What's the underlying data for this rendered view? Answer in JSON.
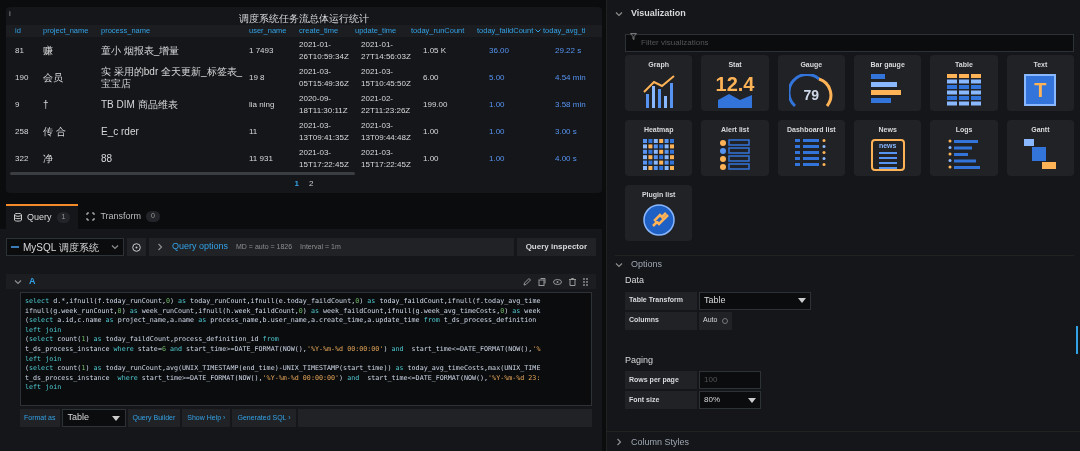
{
  "panel": {
    "title": "调度系统任务流总体运行统计",
    "info": "i",
    "columns": [
      {
        "label": "id",
        "sorted": false
      },
      {
        "label": "project_name",
        "sorted": false
      },
      {
        "label": "process_name",
        "sorted": false
      },
      {
        "label": "user_name",
        "sorted": false
      },
      {
        "label": "create_time",
        "sorted": false
      },
      {
        "label": "update_time",
        "sorted": false
      },
      {
        "label": "today_runCount",
        "sorted": false
      },
      {
        "label": "today_faildCount",
        "sorted": true
      },
      {
        "label": "today_avg_ti",
        "sorted": false
      }
    ],
    "rows": [
      [
        "81",
        "赚",
        "童小 烟报表_增量",
        "1 7493",
        "2021-01-26T10:59:34Z",
        "2021-01-27T14:56:03Z",
        "1.05 K",
        "36.00",
        "29.22 s"
      ],
      [
        "190",
        "会员",
        "实 采用的bdr 全天更新_标签表_宝宝店",
        "19 8",
        "2021-03-05T15:49:36Z",
        "2021-03-15T10:45:50Z",
        "6.00",
        "5.00",
        "4.54 min"
      ],
      [
        "9",
        "†",
        "TB DIM 商品维表",
        "lia ning",
        "2020-09-18T11:30:11Z",
        "2021-02-22T11:23:26Z",
        "199.00",
        "1.00",
        "3.58 min"
      ],
      [
        "258",
        "传 合",
        "E_c rder",
        "11",
        "2021-03-13T09:41:35Z",
        "2021-03-13T09:44:48Z",
        "1.00",
        "1.00",
        "3.00 s"
      ],
      [
        "322",
        "净",
        "88",
        "11 931",
        "2021-03-15T17:22:45Z",
        "2021-03-15T17:22:45Z",
        "1.00",
        "1.00",
        "4.00 s"
      ]
    ],
    "pages": [
      {
        "label": "1",
        "selected": true
      },
      {
        "label": "2",
        "selected": false
      }
    ]
  },
  "editor_tabs": [
    {
      "label": "Query",
      "count": "1",
      "selected": true,
      "kind": "query"
    },
    {
      "label": "Transform",
      "count": "0",
      "selected": false,
      "kind": "transform"
    }
  ],
  "query_bar": {
    "datasource": "MySQL 调度系统",
    "options_label": "Query options",
    "md": "MD = auto = 1826",
    "interval": "Interval = 1m",
    "inspector": "Query inspector"
  },
  "query": {
    "ref": "A",
    "expanded": true,
    "code": [
      "select d.*,ifnull(f.today_runCount,0) as today_runCount,ifnull(e.today_faildCount,0) as today_faildCount,ifnull(f.today_avg_time",
      "ifnull(g.week_runCount,0) as week_runCount,ifnull(h.week_faildCount,0) as week_faildCount,ifnull(g.week_avg_timeCosts,0) as week",
      "(select a.id,c.name as project_name,a.name as process_name,b.user_name,a.create_time,a.update_time from t_ds_process_definition",
      "left join",
      "(select count(1) as today_faildCount,process_definition_id from",
      "t_ds_process_instance where state=6 and start_time>=DATE_FORMAT(NOW(),'%Y-%m-%d 00:00:00') and  start_time<=DATE_FORMAT(NOW(),'%",
      "left join",
      "(select count(1) as today_runCount,avg(UNIX_TIMESTAMP(end_time)-UNIX_TIMESTAMP(start_time)) as today_avg_timeCosts,max(UNIX_TIME",
      "t_ds_process_instance  where start_time>=DATE_FORMAT(NOW(),'%Y-%m-%d 00:00:00') and  start_time<=DATE_FORMAT(NOW(),'%Y-%m-%d 23:",
      "left join"
    ],
    "format_label": "Format as",
    "format_value": "Table",
    "builder": "Query Builder",
    "help": "Show Help ›",
    "generated": "Generated SQL ›"
  },
  "visualization": {
    "title": "Visualization",
    "expanded": true,
    "filter_placeholder": "Filter visualizations",
    "items": [
      {
        "label": "Graph",
        "kind": "graph",
        "selected": false
      },
      {
        "label": "Stat",
        "kind": "stat",
        "selected": false,
        "value": "12.4"
      },
      {
        "label": "Gauge",
        "kind": "gauge",
        "selected": false,
        "value": "79"
      },
      {
        "label": "Bar gauge",
        "kind": "bargauge",
        "selected": false
      },
      {
        "label": "Table",
        "kind": "table",
        "selected": false
      },
      {
        "label": "Text",
        "kind": "text",
        "selected": false,
        "value": "T"
      },
      {
        "label": "Heatmap",
        "kind": "heatmap",
        "selected": false
      },
      {
        "label": "Alert list",
        "kind": "alertlist",
        "selected": false
      },
      {
        "label": "Dashboard list",
        "kind": "dashlist",
        "selected": false
      },
      {
        "label": "News",
        "kind": "news",
        "selected": false,
        "value": "news"
      },
      {
        "label": "Logs",
        "kind": "logs",
        "selected": false
      },
      {
        "label": "Gantt",
        "kind": "gantt",
        "selected": false
      },
      {
        "label": "Plugin list",
        "kind": "pluginlist",
        "selected": false
      }
    ]
  },
  "options": {
    "title": "Options",
    "expanded": true,
    "data_heading": "Data",
    "table_transform": {
      "label": "Table Transform",
      "value": "Table"
    },
    "columns": {
      "label": "Columns",
      "value": "Auto"
    },
    "paging_heading": "Paging",
    "rows_per_page": {
      "label": "Rows per page",
      "placeholder": "100"
    },
    "font_size": {
      "label": "Font size",
      "value": "80%"
    }
  },
  "column_styles": {
    "title": "Column Styles",
    "expanded": false
  }
}
